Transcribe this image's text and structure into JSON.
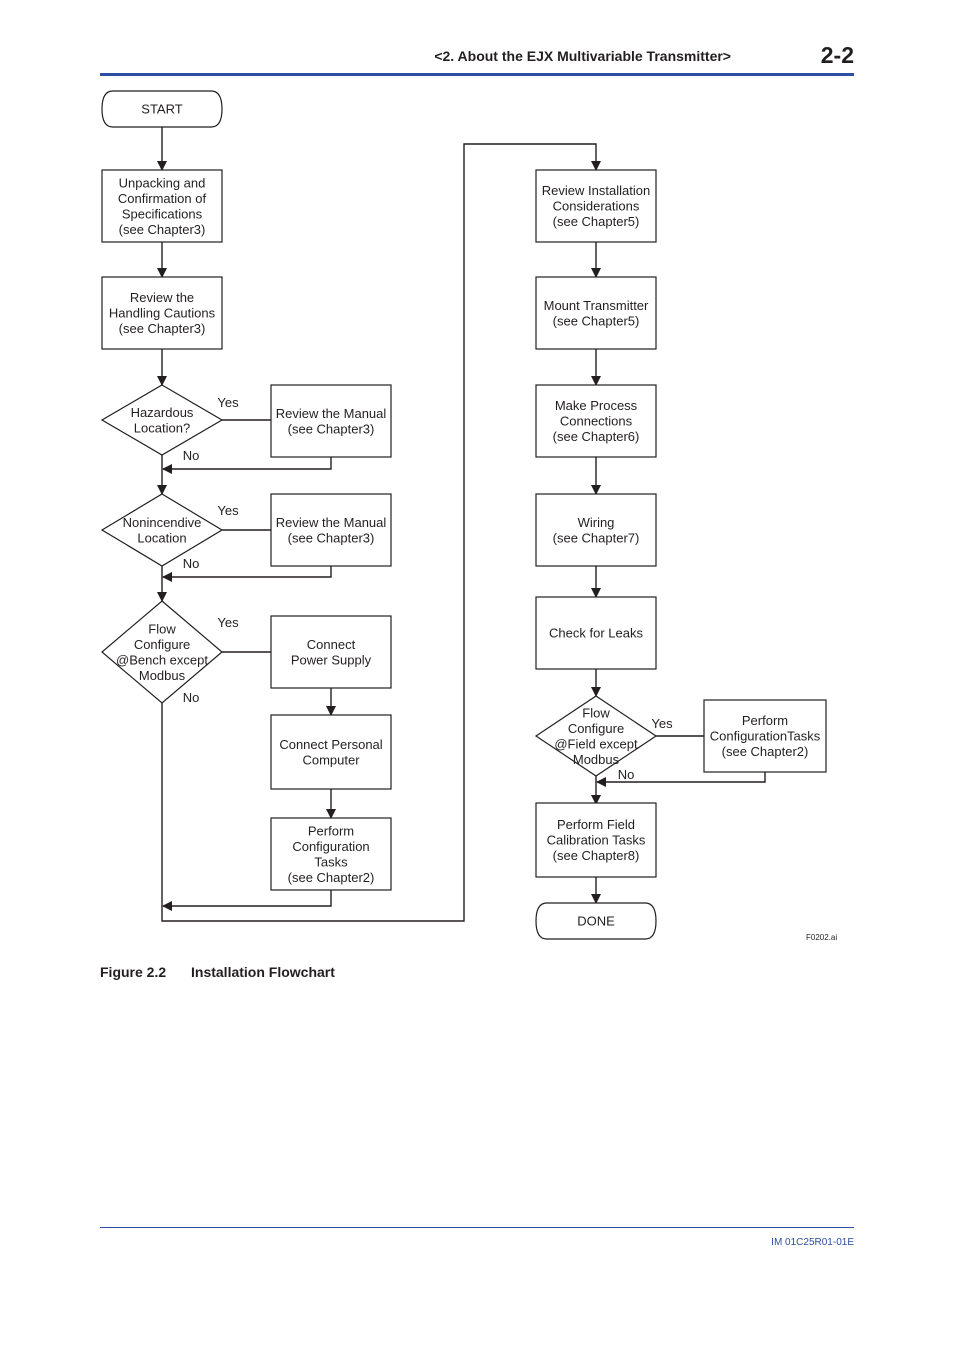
{
  "header": {
    "title": "<2.  About the EJX Multivariable Transmitter>",
    "page_number": "2-2"
  },
  "figure": {
    "number": "Figure 2.2",
    "title": "Installation Flowchart",
    "file_id": "F0202.ai"
  },
  "footer": {
    "doc_id": "IM 01C25R01-01E"
  },
  "flowchart": {
    "nodes": {
      "start": [
        "START"
      ],
      "unpacking": [
        "Unpacking and",
        "Confirmation of",
        "Specifications",
        "(see Chapter3)"
      ],
      "handling": [
        "Review the",
        "Handling Cautions",
        "(see Chapter3)"
      ],
      "hazardous": [
        "Hazardous",
        "Location?"
      ],
      "manual1": [
        "Review the Manual",
        "(see Chapter3)"
      ],
      "nonincendive": [
        "Nonincendive",
        "Location"
      ],
      "manual2": [
        "Review the Manual",
        "(see Chapter3)"
      ],
      "bench": [
        "Flow",
        "Configure",
        "@Bench except",
        "Modbus"
      ],
      "power": [
        "Connect",
        "Power Supply"
      ],
      "pc": [
        "Connect Personal",
        "Computer"
      ],
      "config1": [
        "Perform",
        "Configuration",
        "Tasks",
        "(see Chapter2)"
      ],
      "install": [
        "Review Installation",
        "Considerations",
        "(see Chapter5)"
      ],
      "mount": [
        "Mount Transmitter",
        "(see Chapter5)"
      ],
      "process": [
        "Make Process",
        "Connections",
        "(see Chapter6)"
      ],
      "wiring": [
        "Wiring",
        "(see Chapter7)"
      ],
      "leaks": [
        "Check for Leaks"
      ],
      "field": [
        "Flow",
        "Configure",
        "@Field except",
        "Modbus"
      ],
      "config2": [
        "Perform",
        "ConfigurationTasks",
        "(see Chapter2)"
      ],
      "calibration": [
        "Perform Field",
        "Calibration Tasks",
        "(see Chapter8)"
      ],
      "done": [
        "DONE"
      ]
    },
    "branch_labels": {
      "yes": "Yes",
      "no": "No"
    }
  }
}
